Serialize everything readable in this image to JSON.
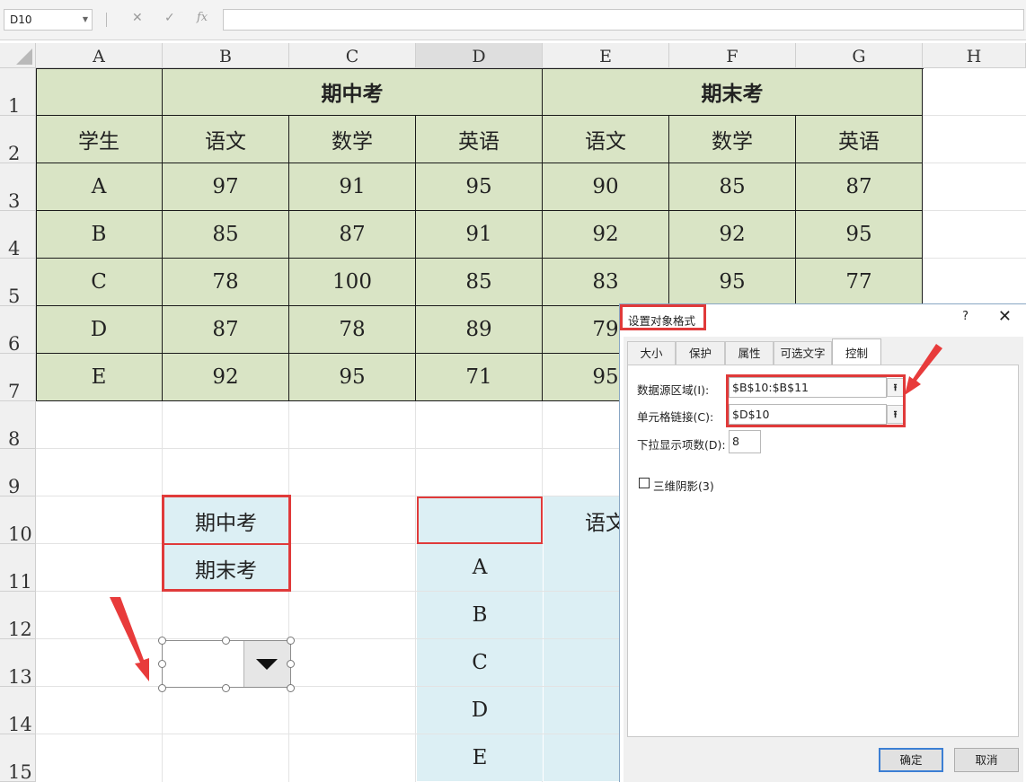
{
  "name_box": "D10",
  "formula_bar": {
    "cancel_icon": "✕",
    "enter_icon": "✓",
    "fx_label": "fx",
    "value": ""
  },
  "columns": [
    "A",
    "B",
    "C",
    "D",
    "E",
    "F",
    "G",
    "H"
  ],
  "rows": [
    "1",
    "2",
    "3",
    "4",
    "5",
    "6",
    "7",
    "8",
    "9",
    "10",
    "11",
    "12",
    "13",
    "14",
    "15"
  ],
  "table": {
    "header1": {
      "midterm": "期中考",
      "final": "期末考"
    },
    "header2": [
      "学生",
      "语文",
      "数学",
      "英语",
      "语文",
      "数学",
      "英语"
    ],
    "data": [
      [
        "A",
        "97",
        "91",
        "95",
        "90",
        "85",
        "87"
      ],
      [
        "B",
        "85",
        "87",
        "91",
        "92",
        "92",
        "95"
      ],
      [
        "C",
        "78",
        "100",
        "85",
        "83",
        "95",
        "77"
      ],
      [
        "D",
        "87",
        "78",
        "89",
        "79",
        "",
        ""
      ],
      [
        "E",
        "92",
        "95",
        "71",
        "95",
        "",
        ""
      ]
    ]
  },
  "options_list": [
    "期中考",
    "期末考"
  ],
  "lookup": {
    "header_e": "语文",
    "students": [
      "A",
      "B",
      "C",
      "D",
      "E"
    ]
  },
  "dialog": {
    "title": "设置对象格式",
    "help": "?",
    "close": "✕",
    "tabs": [
      "大小",
      "保护",
      "属性",
      "可选文字",
      "控制"
    ],
    "active_tab": "控制",
    "input_range_label": "数据源区域(I):",
    "input_range_value": "$B$10:$B$11",
    "cell_link_label": "单元格链接(C):",
    "cell_link_value": "$D$10",
    "dropdown_lines_label": "下拉显示项数(D):",
    "dropdown_lines_value": "8",
    "shading_label": "三维阴影(3)",
    "ok": "确定",
    "cancel": "取消"
  },
  "colors": {
    "table_green": "#d9e4c5",
    "lookup_blue": "#dceff4",
    "highlight_red": "#e03a3a"
  }
}
